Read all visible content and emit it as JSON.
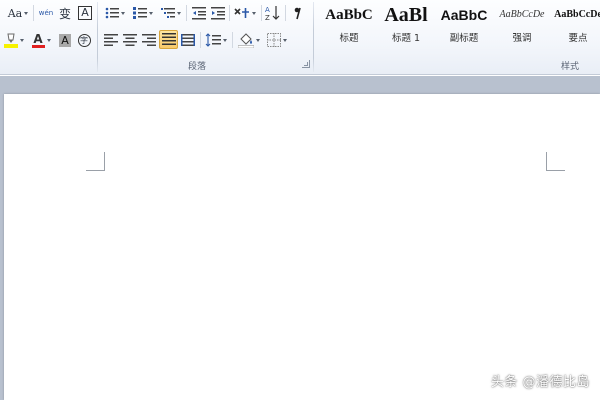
{
  "ribbon": {
    "font_group": {
      "font_size_label": "Aa",
      "phonetic_label": "wén",
      "change_case_label": "变",
      "char_border_label": "A",
      "font_color_label": "A",
      "char_shading_label": "A",
      "enclose_char_label": "字"
    },
    "paragraph_group": {
      "label": "段落"
    },
    "styles_group": {
      "label": "样式",
      "items": [
        {
          "sample": "AaBbC",
          "name": "标题"
        },
        {
          "sample": "AaBl",
          "name": "标题 1"
        },
        {
          "sample": "AaBbC",
          "name": "副标题"
        },
        {
          "sample": "AaBbCcDe",
          "name": "强调"
        },
        {
          "sample": "AaBbCcDe",
          "name": "要点"
        }
      ]
    }
  },
  "colors": {
    "highlight": "#f7f200",
    "font_color": "#e02020",
    "active_button": "#f8c969",
    "doc_background": "#b8c1cf"
  },
  "watermark": "头条 @潘德比岛"
}
